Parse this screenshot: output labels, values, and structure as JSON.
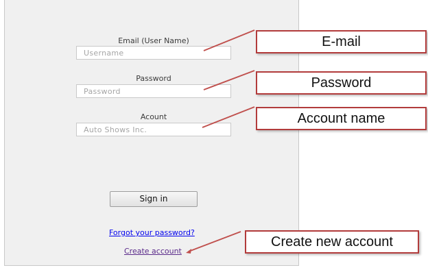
{
  "login_form": {
    "email": {
      "label": "Email (User Name)",
      "placeholder": "Username"
    },
    "password": {
      "label": "Password",
      "placeholder": "Password"
    },
    "account": {
      "label": "Acount",
      "placeholder": "Auto Shows Inc."
    },
    "sign_in_label": "Sign in",
    "forgot_password_link": "Forgot your password?",
    "create_account_link": "Create account"
  },
  "callouts": {
    "email": "E-mail",
    "password": "Password",
    "account": "Account name",
    "create_account": "Create new account"
  },
  "colors": {
    "panel_background": "#f0f0f0",
    "callout_border": "#b23b3b",
    "leader_line": "#c0504d",
    "link": "#0000ee",
    "visited_link": "#5a2a8a"
  }
}
